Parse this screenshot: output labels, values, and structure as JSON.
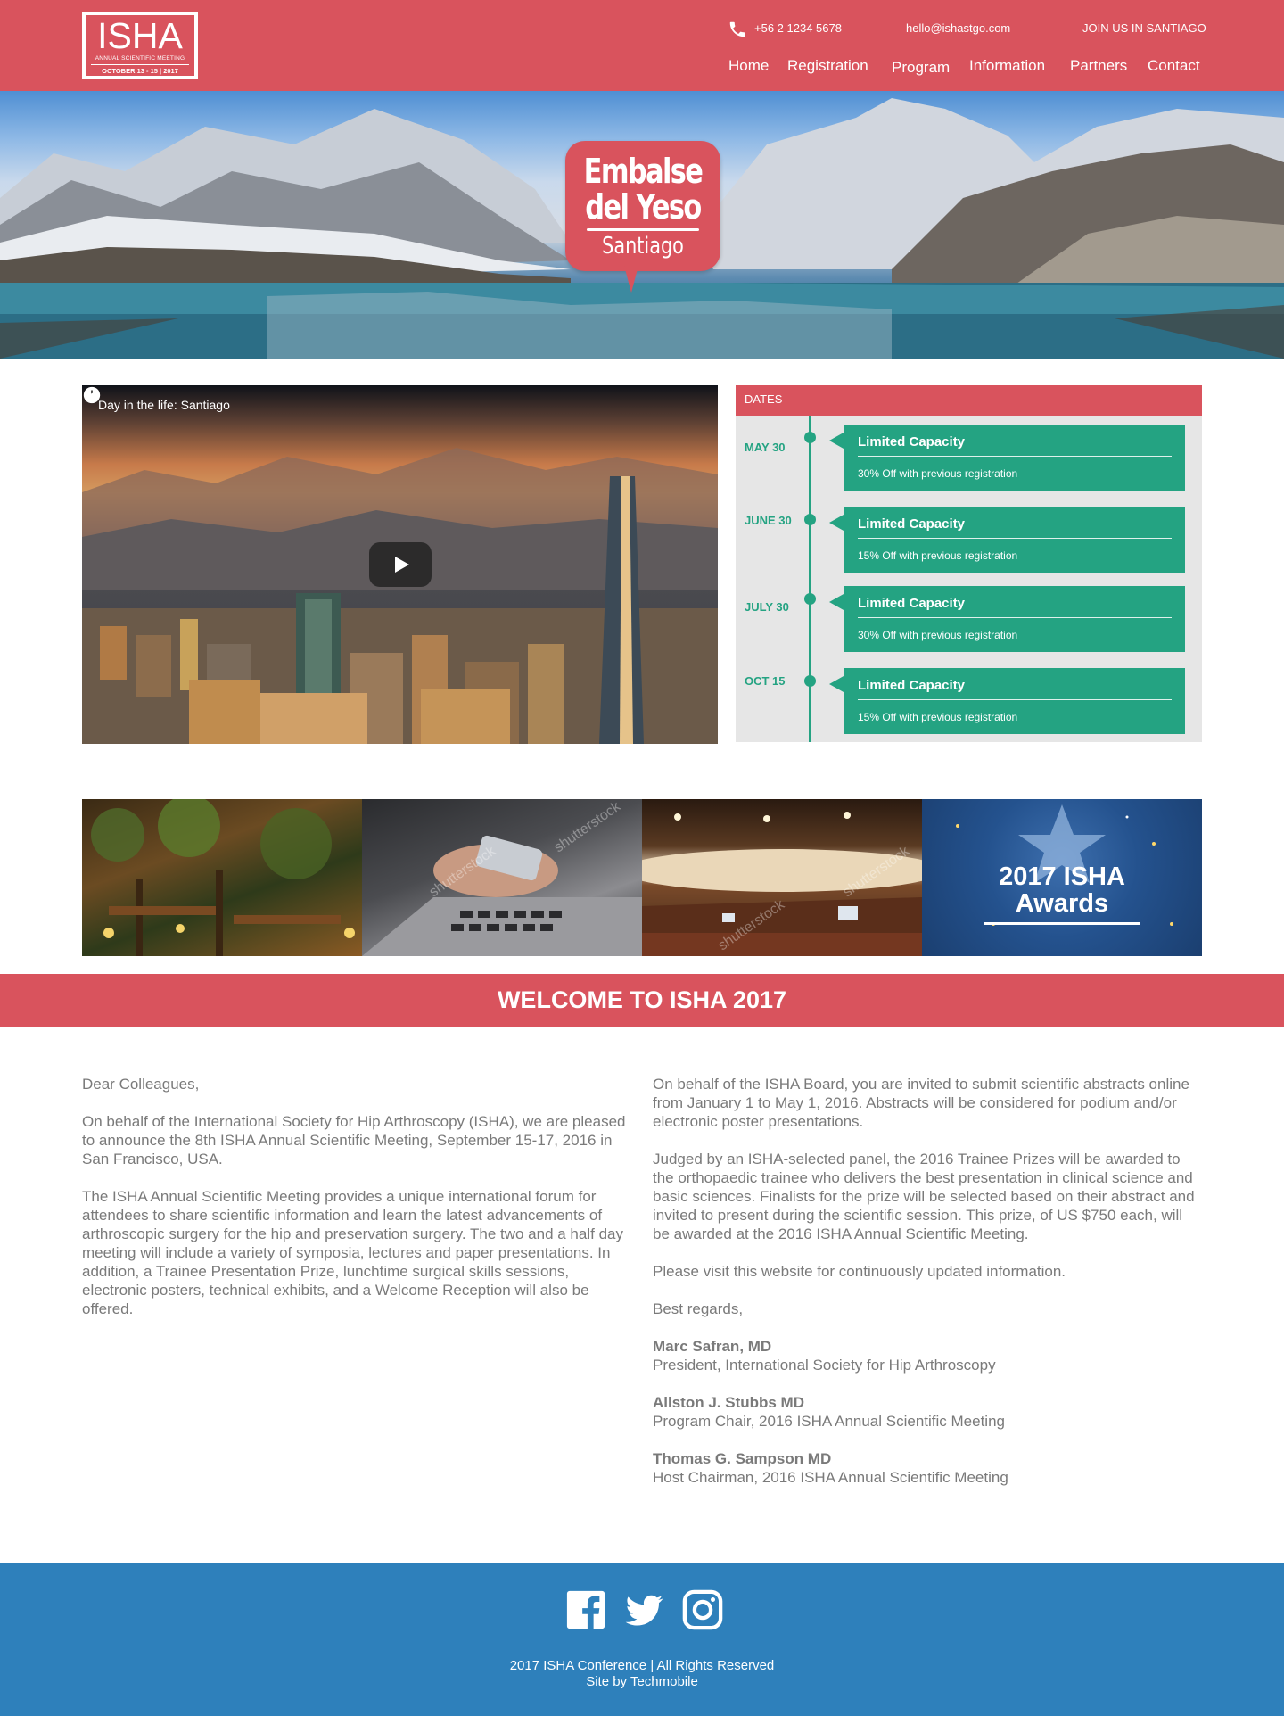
{
  "brand": {
    "logo_title": "ISHA",
    "logo_subtitle": "ANNUAL SCIENTIFIC MEETING",
    "logo_dates": "OCTOBER 13 - 15 | 2017",
    "primary_color": "#d9535d",
    "accent_color": "#24a382",
    "footer_color": "#2e80bb"
  },
  "topbar": {
    "phone_icon": "phone-icon",
    "phone": "+56 2 1234 5678",
    "email": "hello@ishastgo.com",
    "join": "JOIN US IN SANTIAGO"
  },
  "nav": {
    "items": [
      "Home",
      "Registration",
      "Program",
      "Information",
      "Partners",
      "Contact"
    ]
  },
  "hero": {
    "badge_line1": "Embalse",
    "badge_line2": "del Yeso",
    "badge_line3": "Santiago"
  },
  "video": {
    "title": "Day in the life: Santiago",
    "icons": [
      "clock-icon",
      "share-icon",
      "play-icon"
    ]
  },
  "dates": {
    "header": "DATES",
    "items": [
      {
        "date": "MAY 30",
        "title": "Limited Capacity",
        "text": "30% Off with previous registration"
      },
      {
        "date": "JUNE 30",
        "title": "Limited Capacity",
        "text": "15% Off with previous registration"
      },
      {
        "date": "JULY 30",
        "title": "Limited Capacity",
        "text": "30% Off with previous registration"
      },
      {
        "date": "OCT 15",
        "title": "Limited Capacity",
        "text": "15% Off with previous registration"
      }
    ]
  },
  "gallery": {
    "watermark": "shutterstock",
    "awards_line1": "2017 ISHA",
    "awards_line2": "Awards"
  },
  "welcome": {
    "title": "WELCOME TO ISHA 2017",
    "left": [
      "Dear Colleagues,",
      "On behalf of the International Society for Hip Arthroscopy (ISHA), we are pleased to announce the 8th ISHA Annual Scientific Meeting, September 15-17, 2016 in San Francisco, USA.",
      "The ISHA Annual Scientific Meeting provides a unique international forum for attendees to share scientific information and learn the latest advancements of arthroscopic surgery for the hip and preservation surgery. The two and a half day meeting will include a variety of symposia, lectures and paper presentations. In addition, a Trainee Presentation Prize, lunchtime surgical skills sessions, electronic posters, technical exhibits, and a Welcome Reception will also be offered."
    ],
    "right": [
      "On behalf of the ISHA Board, you are invited to submit scientific abstracts online from January 1 to May 1, 2016. Abstracts will be considered for podium and/or electronic poster presentations.",
      "Judged by an ISHA-selected panel, the 2016 Trainee Prizes will be awarded to the orthopaedic trainee who delivers the best presentation in clinical science and basic sciences. Finalists for the prize will be selected based on their abstract and invited to present during the scientific session. This prize, of US $750 each, will be awarded at the 2016 ISHA Annual Scientific Meeting.",
      "Please visit this website for continuously updated information.",
      "Best regards,"
    ],
    "signatures": [
      {
        "name": "Marc Safran, MD",
        "role": "President, International Society for Hip Arthroscopy"
      },
      {
        "name": "Allston J. Stubbs MD",
        "role": "Program Chair, 2016 ISHA Annual Scientific Meeting"
      },
      {
        "name": "Thomas G. Sampson MD",
        "role": "Host Chairman, 2016 ISHA Annual Scientific Meeting"
      }
    ]
  },
  "footer": {
    "social_icons": [
      "facebook-icon",
      "twitter-icon",
      "instagram-icon"
    ],
    "copyright": "2017 ISHA Conference | All Rights Reserved",
    "credit": "Site by Techmobile"
  }
}
